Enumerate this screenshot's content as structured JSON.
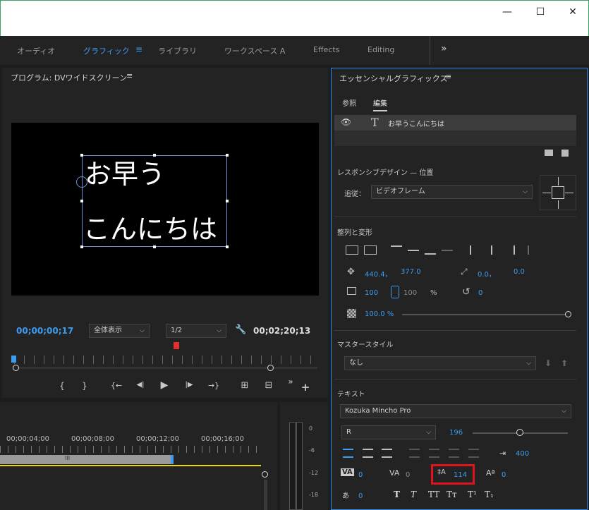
{
  "window": {
    "minimize": "—",
    "maximize": "☐",
    "close": "✕"
  },
  "workspaces": {
    "tabs": [
      "オーディオ",
      "グラフィック",
      "ライブラリ",
      "ワークスペース A",
      "Effects",
      "Editing"
    ],
    "menu_icon": "≡",
    "more": "»"
  },
  "program": {
    "title": "プログラム: DVワイドスクリーン",
    "menu_icon": "≡",
    "line1": "お早う",
    "line2": "こんにちは",
    "timecode_current": "00;00;00;17",
    "zoom_label": "全体表示",
    "resolution": "1/2",
    "timecode_duration": "00;02;20;13"
  },
  "transport": {
    "mark_in": "{",
    "mark_out": "}",
    "go_in": "{←",
    "step_back": "◀|",
    "play": "▶",
    "step_fwd": "|▶",
    "go_out": "→}",
    "lift": "⊞",
    "extract": "⊟",
    "more": "»",
    "add": "+"
  },
  "timeline": {
    "ticks": [
      "00;00;04;00",
      "00;00;08;00",
      "00;00;12;00",
      "00;00;16;00"
    ],
    "clip_marker": "III"
  },
  "meter": {
    "labels": [
      "0",
      "-6",
      "-12",
      "-18"
    ]
  },
  "essential": {
    "title": "エッセンシャルグラフィックス",
    "menu_icon": "≡",
    "tab_browse": "参照",
    "tab_edit": "編集",
    "layer_name": "お早うこんにちは",
    "responsive_title": "レスポンシブデザイン — 位置",
    "follow_label": "追従：",
    "follow_value": "ビデオフレーム",
    "align_title": "整列と変形",
    "pos_x": "440.4，",
    "pos_y": "377.0",
    "anchor_x": "0.0，",
    "anchor_y": "0.0",
    "scale": "100",
    "scale2": "100",
    "scale_unit": "%",
    "rotation": "0",
    "opacity": "100.0 %",
    "opacity_level": 1.0,
    "master_title": "マスタースタイル",
    "master_value": "なし",
    "text_title": "テキスト",
    "font": "Kozuka Mincho Pro",
    "style": "R",
    "size": "196",
    "tracking_box": "400",
    "kerning": "0",
    "tracking": "0",
    "leading": "114",
    "baseline": "0",
    "tsume": "0",
    "style_buttons": [
      "T",
      "T",
      "TT",
      "Tт",
      "T¹",
      "T₁"
    ]
  },
  "colors": {
    "accent": "#3d9cf0",
    "highlight": "#e0141e",
    "playhead": "#e03030",
    "bar": "#f0d800"
  }
}
